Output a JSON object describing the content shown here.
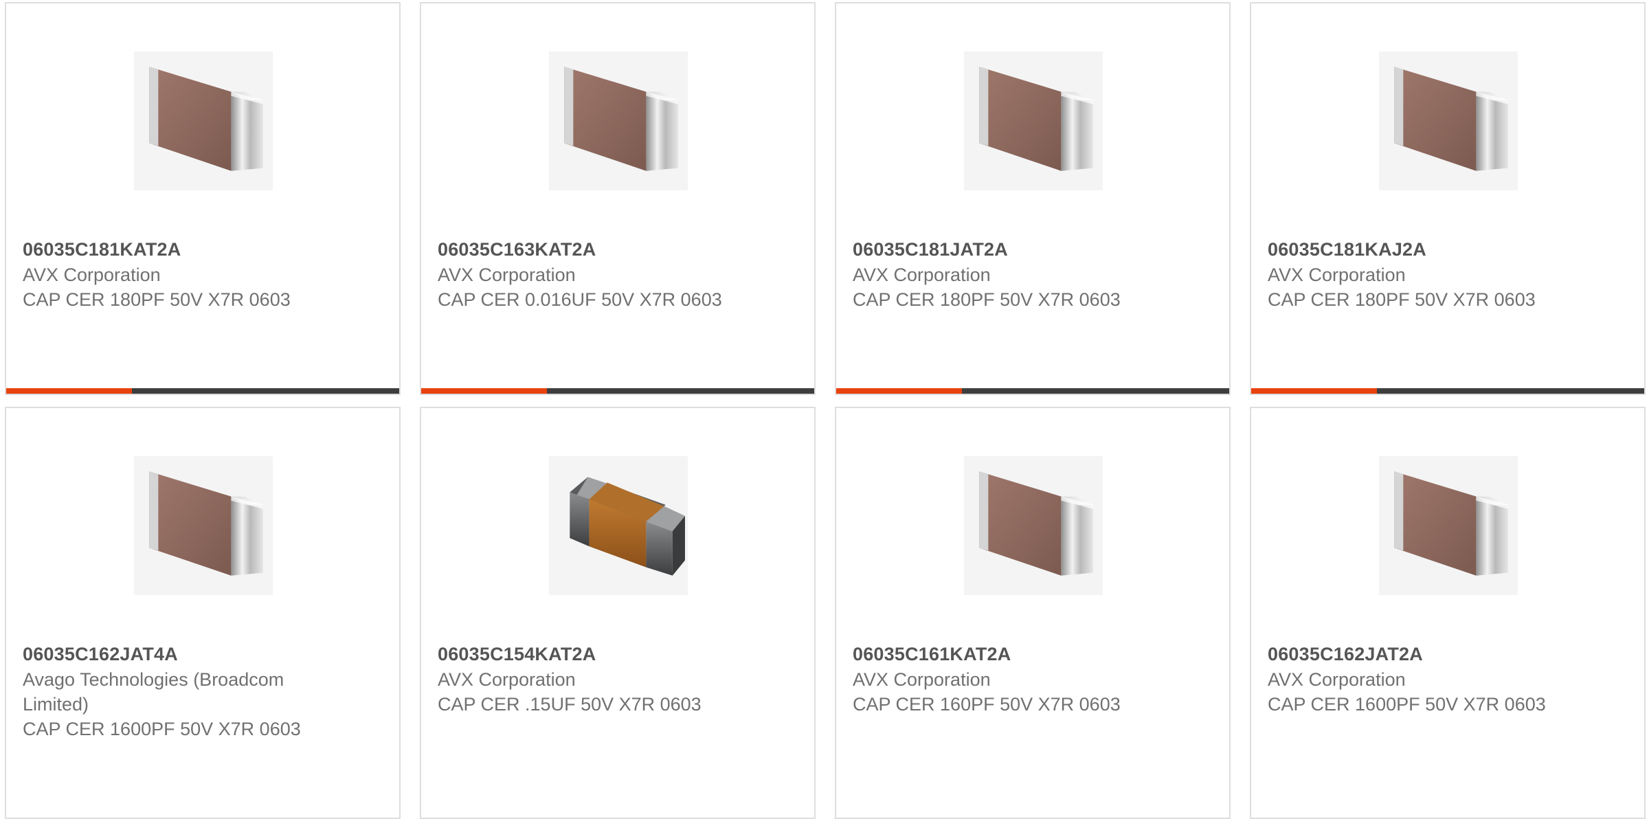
{
  "colors": {
    "accent": "#e8420e",
    "bar_track": "#3e3e3e",
    "card_border": "#dedede",
    "part_number": "#555555",
    "secondary_text": "#707070"
  },
  "products": [
    {
      "part_number": "06035C181KAT2A",
      "manufacturer": "AVX Corporation",
      "description": "CAP CER 180PF 50V X7R 0603",
      "image_icon": "ceramic-capacitor-brown",
      "bar_fill_fraction": 0.32
    },
    {
      "part_number": "06035C163KAT2A",
      "manufacturer": "AVX Corporation",
      "description": "CAP CER 0.016UF 50V X7R 0603",
      "image_icon": "ceramic-capacitor-brown",
      "bar_fill_fraction": 0.32
    },
    {
      "part_number": "06035C181JAT2A",
      "manufacturer": "AVX Corporation",
      "description": "CAP CER 180PF 50V X7R 0603",
      "image_icon": "ceramic-capacitor-brown",
      "bar_fill_fraction": 0.32
    },
    {
      "part_number": "06035C181KAJ2A",
      "manufacturer": "AVX Corporation",
      "description": "CAP CER 180PF 50V X7R 0603",
      "image_icon": "ceramic-capacitor-brown",
      "bar_fill_fraction": 0.32
    },
    {
      "part_number": "06035C162JAT4A",
      "manufacturer": "Avago Technologies (Broadcom Limited)",
      "description": "CAP CER 1600PF 50V X7R 0603",
      "image_icon": "ceramic-capacitor-brown"
    },
    {
      "part_number": "06035C154KAT2A",
      "manufacturer": "AVX Corporation",
      "description": "CAP CER .15UF 50V X7R 0603",
      "image_icon": "chip-capacitor-orange"
    },
    {
      "part_number": "06035C161KAT2A",
      "manufacturer": "AVX Corporation",
      "description": "CAP CER 160PF 50V X7R 0603",
      "image_icon": "ceramic-capacitor-brown"
    },
    {
      "part_number": "06035C162JAT2A",
      "manufacturer": "AVX Corporation",
      "description": "CAP CER 1600PF 50V X7R 0603",
      "image_icon": "ceramic-capacitor-brown"
    }
  ]
}
